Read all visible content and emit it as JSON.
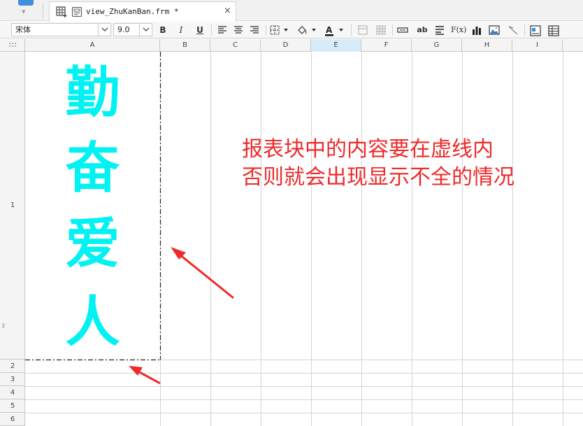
{
  "tab": {
    "title": "view_ZhuKanBan.frm *",
    "close_glyph": "×"
  },
  "toolbar": {
    "font_name": "宋体",
    "font_size": "9.0",
    "bold_label": "B",
    "italic_label": "I",
    "underline_label": "U",
    "text_field_label": "ab",
    "formula_label": "F(x)"
  },
  "grid": {
    "columns": [
      "A",
      "B",
      "C",
      "D",
      "E",
      "F",
      "G",
      "H",
      "I"
    ],
    "selected_column": "E",
    "rows": [
      "1",
      "2",
      "3",
      "4",
      "5",
      "6"
    ]
  },
  "block": {
    "chars": [
      "勤",
      "奋",
      "爱",
      "人"
    ],
    "color": "#00f2f2"
  },
  "annotation": {
    "line1": "报表块中的内容要在虚线内",
    "line2": "否则就会出现显示不全的情况",
    "color": "#ee2a2a"
  },
  "icons": {
    "app": "app-logo-icon",
    "grid_tab": "grid-add-icon",
    "form_file": "form-file-icon"
  }
}
